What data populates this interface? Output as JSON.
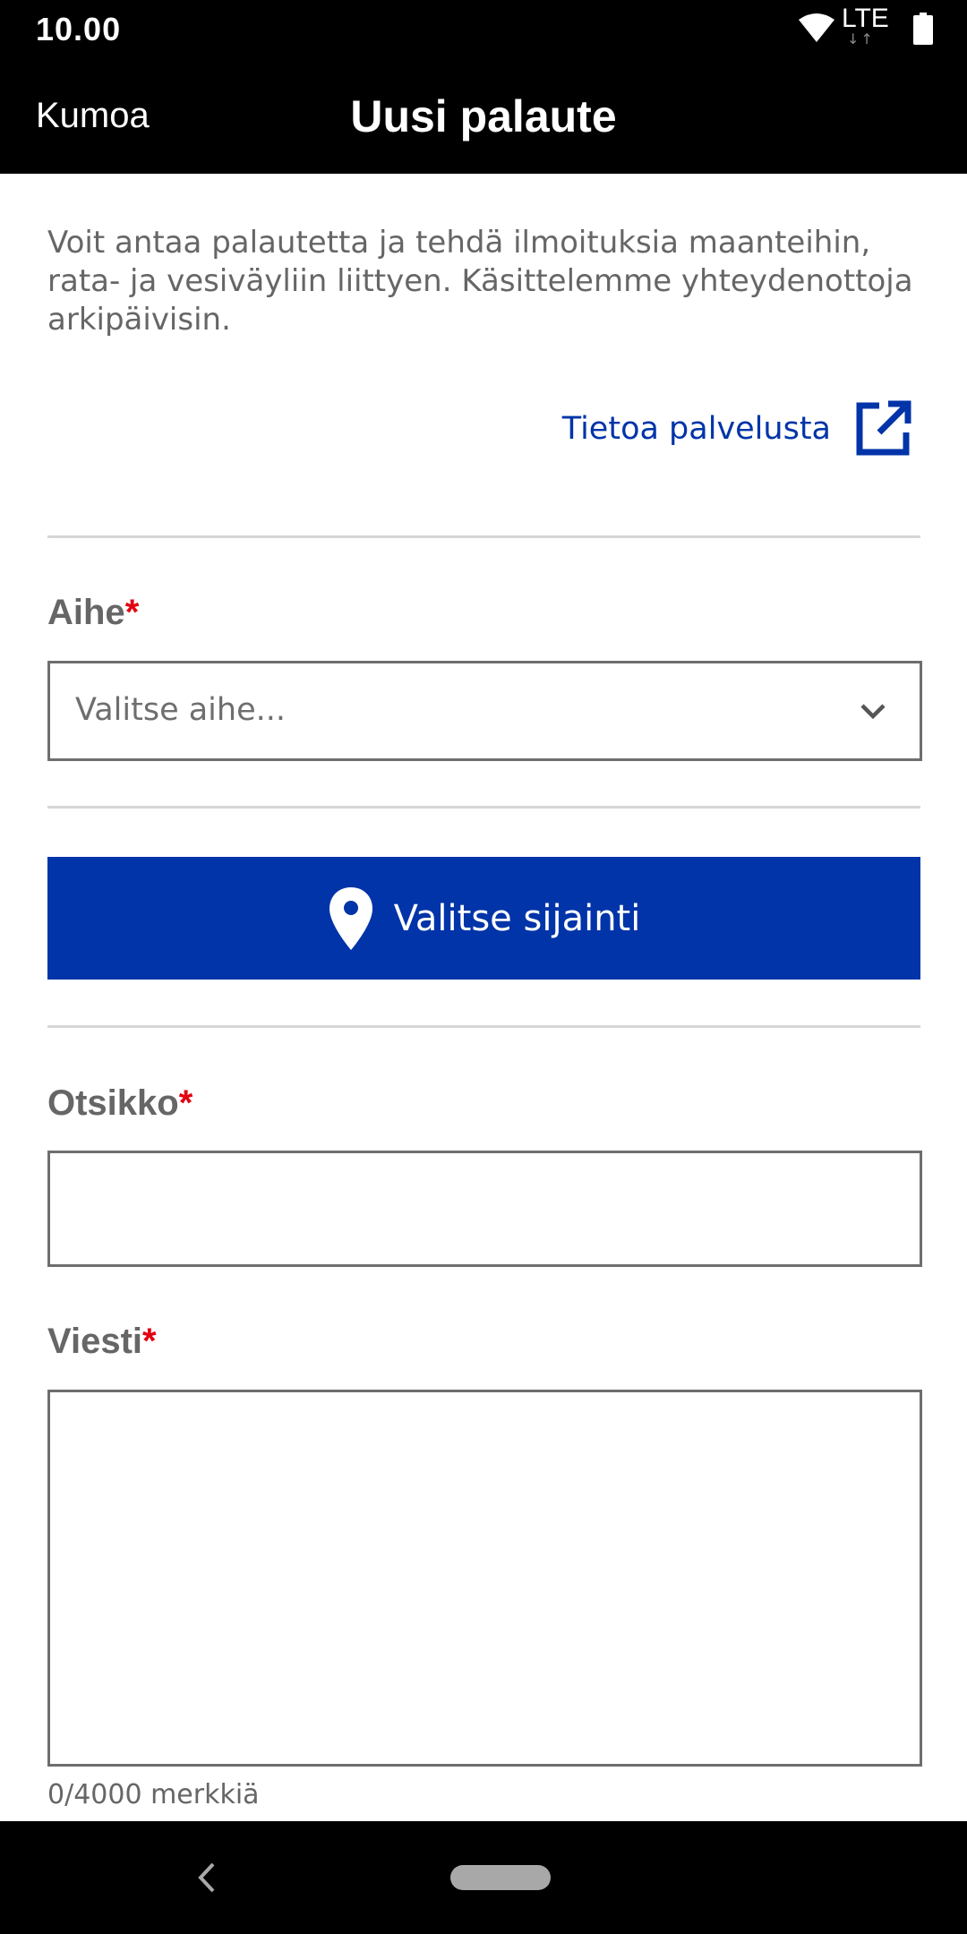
{
  "status_bar": {
    "time": "10.00",
    "network": "LTE"
  },
  "header": {
    "cancel_label": "Kumoa",
    "title": "Uusi palaute"
  },
  "intro": {
    "text": "Voit antaa palautetta ja tehdä ilmoituksia maanteihin, rata- ja vesiväyliin liittyen. Käsittelemme yhteydenottoja arkipäivisin.",
    "info_link_label": "Tietoa palvelusta"
  },
  "form": {
    "topic": {
      "label": "Aihe",
      "required_mark": "*",
      "placeholder": "Valitse aihe..."
    },
    "location_button_label": "Valitse sijainti",
    "subject": {
      "label": "Otsikko",
      "required_mark": "*",
      "value": ""
    },
    "message": {
      "label": "Viesti",
      "required_mark": "*",
      "value": "",
      "counter": "0/4000 merkkiä"
    }
  },
  "colors": {
    "primary_blue": "#0034a8",
    "required_red": "#e3000f",
    "label_gray": "#666666",
    "bar_black": "#000000"
  },
  "icons": [
    "wifi-icon",
    "lte-icon",
    "battery-icon",
    "external-link-icon",
    "chevron-down-icon",
    "map-pin-icon",
    "back-icon",
    "home-handle"
  ]
}
